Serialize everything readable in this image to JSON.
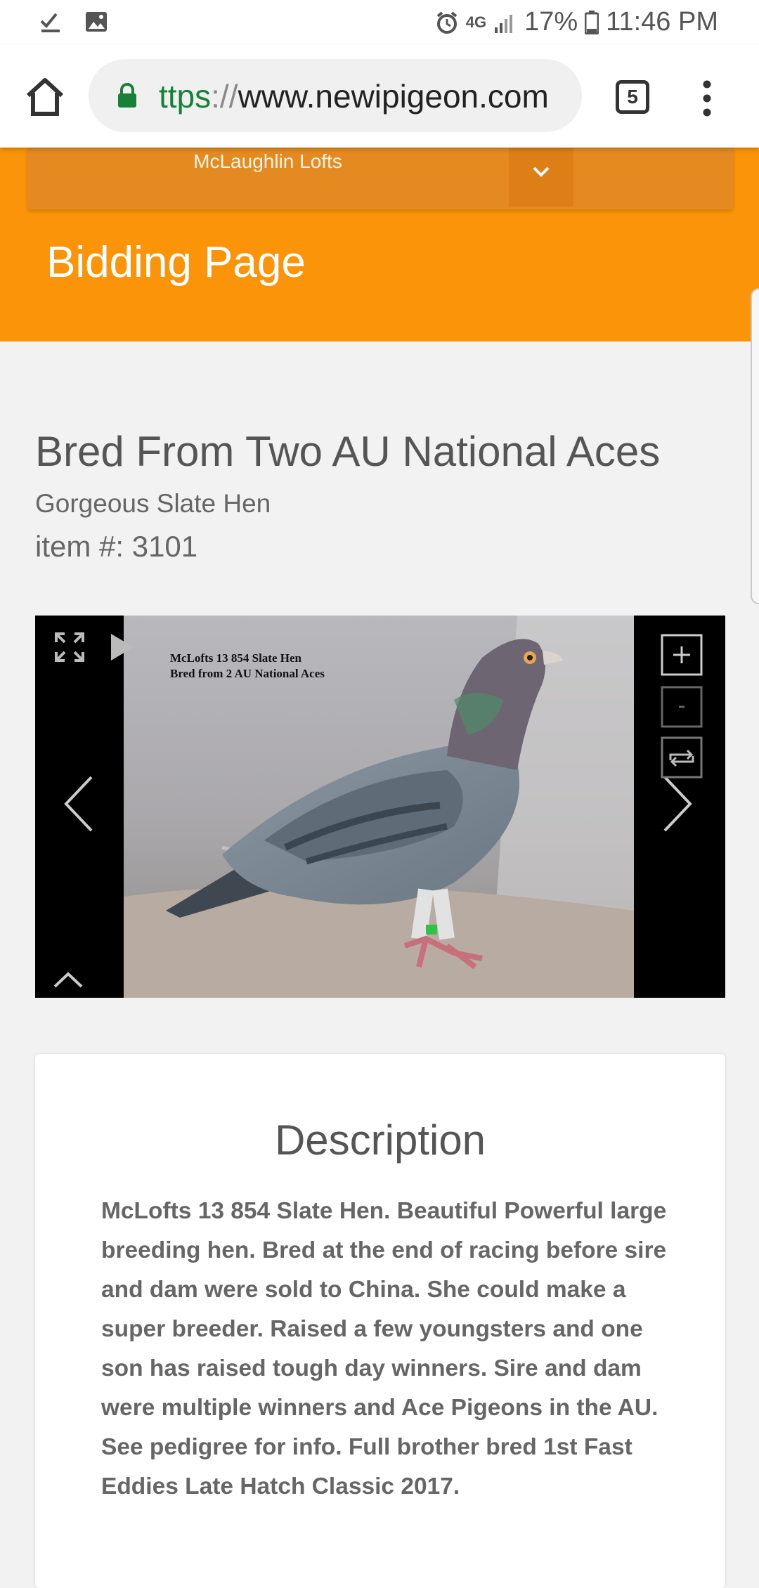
{
  "status_bar": {
    "left_icons": [
      "download-done-icon",
      "image-icon"
    ],
    "network": "4G",
    "battery": "17%",
    "time": "11:46 PM"
  },
  "browser": {
    "url_scheme": "ttps",
    "url_sep": "://",
    "url_host": "www.newipigeon.com",
    "tab_count": "5"
  },
  "header": {
    "loft_select": "McLaughlin Lofts",
    "page_title": "Bidding Page",
    "color": "#fb9408"
  },
  "item": {
    "title": "Bred From Two AU National Aces",
    "subtitle": "Gorgeous Slate Hen",
    "item_number": "item #: 3101"
  },
  "gallery": {
    "caption_line1": "McLofts 13 854 Slate Hen",
    "caption_line2": "Bred from 2 AU National Aces",
    "controls": [
      "fullscreen-icon",
      "play-icon",
      "zoom-in-icon",
      "zoom-out-icon",
      "rotate-icon",
      "prev-arrow-icon",
      "next-arrow-icon",
      "collapse-icon"
    ]
  },
  "description": {
    "heading": "Description",
    "text": "McLofts 13 854 Slate Hen.  Beautiful Powerful large breeding hen.  Bred at the end of racing before sire and dam were sold to China.  She could make a super breeder.  Raised a few youngsters and one son has raised tough day winners.  Sire and dam were multiple winners and Ace Pigeons in the AU.  See pedigree for info. Full brother bred 1st Fast Eddies Late Hatch Classic 2017."
  }
}
